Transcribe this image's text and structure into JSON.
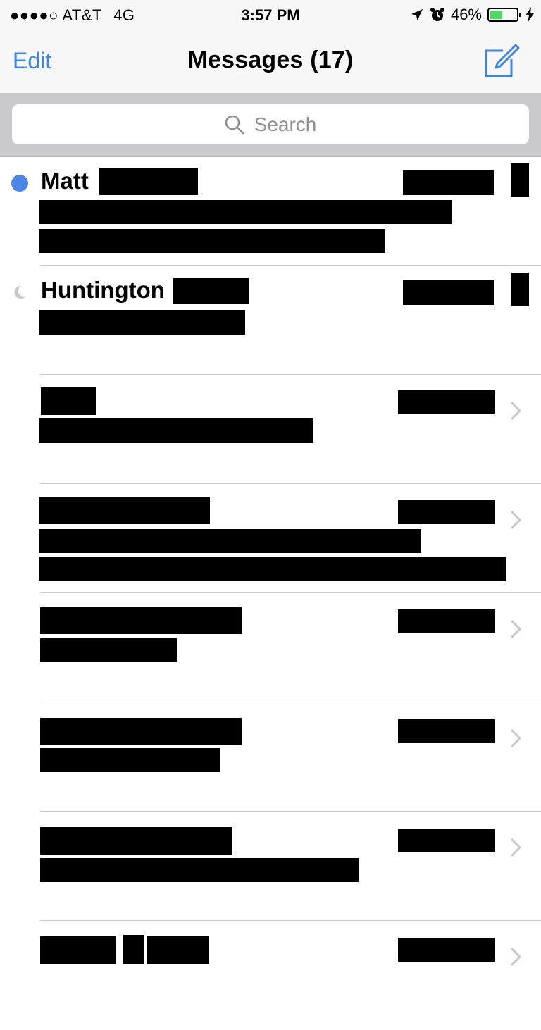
{
  "status_bar": {
    "signal_dots": "●●●●○",
    "carrier": "AT&T",
    "network": "4G",
    "time": "3:57 PM",
    "battery_percent": "46%",
    "battery_level": 0.46,
    "icons": [
      "location-arrow-icon",
      "alarm-clock-icon",
      "battery-icon",
      "charging-bolt-icon"
    ]
  },
  "nav": {
    "edit_label": "Edit",
    "title": "Messages (17)",
    "compose_icon": "compose-icon"
  },
  "search": {
    "placeholder": "Search"
  },
  "colors": {
    "accent": "#3c87e6",
    "unread_dot": "#4a86e8",
    "battery_fill": "#4cd964"
  },
  "conversations": [
    {
      "name": "Matt",
      "status": "unread"
    },
    {
      "name": "Huntington",
      "status": "do-not-disturb"
    },
    {
      "name": "",
      "status": "read"
    },
    {
      "name": "",
      "status": "read"
    },
    {
      "name": "",
      "status": "read"
    },
    {
      "name": "",
      "status": "read"
    },
    {
      "name": "",
      "status": "read"
    },
    {
      "name": "",
      "status": "read"
    }
  ]
}
